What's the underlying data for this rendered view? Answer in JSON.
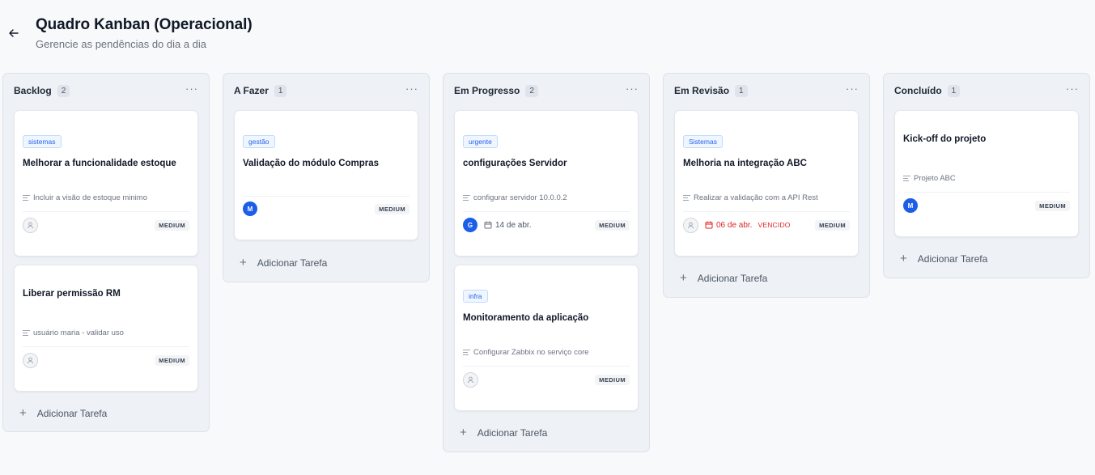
{
  "header": {
    "title": "Quadro Kanban (Operacional)",
    "subtitle": "Gerencie as pendências do dia a dia"
  },
  "icons": {
    "back": "arrow-left-icon",
    "menu": "more-horizontal-icon",
    "description": "text-lines-icon",
    "calendar": "calendar-icon",
    "user": "user-icon",
    "add": "plus-icon"
  },
  "colors": {
    "tag": "#2563eb",
    "avatar": "#1d5ee8",
    "overdue": "#dc2626"
  },
  "add_task_label": "Adicionar Tarefa",
  "columns": [
    {
      "title": "Backlog",
      "count": "2",
      "cards": [
        {
          "tag": "sistemas",
          "title": "Melhorar a funcionalidade estoque",
          "description": "Incluir a visão de estoque minimo",
          "assignee": "",
          "due": "",
          "overdue": "",
          "priority": "MEDIUM"
        },
        {
          "tag": "",
          "title": "Liberar permissão RM",
          "description": "usuário maria - validar uso",
          "assignee": "",
          "due": "",
          "overdue": "",
          "priority": "MEDIUM"
        }
      ]
    },
    {
      "title": "A Fazer",
      "count": "1",
      "cards": [
        {
          "tag": "gestão",
          "title": "Validação do módulo Compras",
          "description": "",
          "assignee": "M",
          "due": "",
          "overdue": "",
          "priority": "MEDIUM"
        }
      ]
    },
    {
      "title": "Em Progresso",
      "count": "2",
      "cards": [
        {
          "tag": "urgente",
          "title": "configurações Servidor",
          "description": "configurar servidor 10.0.0.2",
          "assignee": "G",
          "due": "14 de abr.",
          "overdue": "",
          "priority": "MEDIUM"
        },
        {
          "tag": "infra",
          "title": "Monitoramento da aplicação",
          "description": "Configurar Zabbix no serviço core",
          "assignee": "",
          "due": "",
          "overdue": "",
          "priority": "MEDIUM"
        }
      ]
    },
    {
      "title": "Em Revisão",
      "count": "1",
      "cards": [
        {
          "tag": "Sistemas",
          "title": "Melhoria na integração ABC",
          "description": "Realizar a validação com a API Rest",
          "assignee": "",
          "due": "06 de abr.",
          "overdue": "VENCIDO",
          "priority": "MEDIUM"
        }
      ]
    },
    {
      "title": "Concluído",
      "count": "1",
      "cards": [
        {
          "tag": "",
          "title": "Kick-off do projeto",
          "description": "Projeto ABC",
          "assignee": "M",
          "due": "",
          "overdue": "",
          "priority": "MEDIUM"
        }
      ]
    }
  ]
}
